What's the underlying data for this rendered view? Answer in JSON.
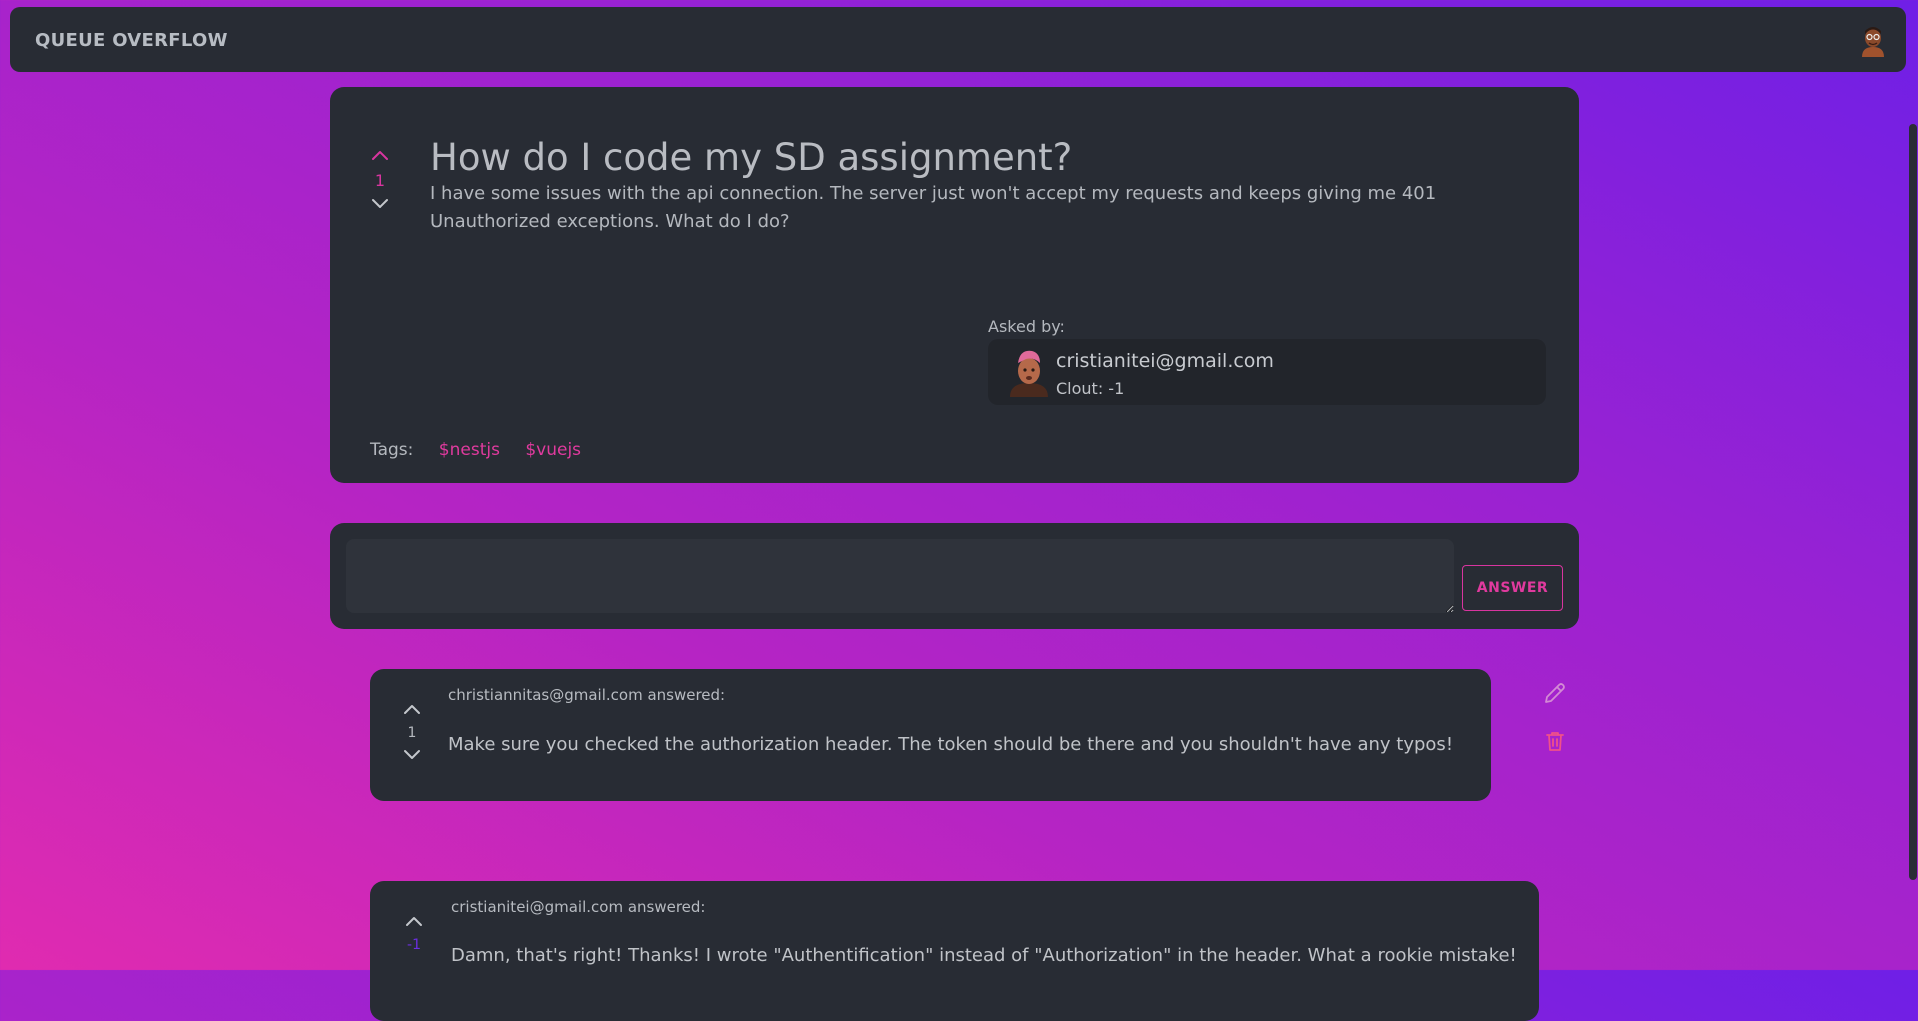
{
  "app": {
    "brand": "QUEUE OVERFLOW"
  },
  "question": {
    "title": "How do I code my SD assignment?",
    "body": "I have some issues with the api connection. The server just won't accept my requests and keeps giving me 401 Unauthorized exceptions. What do I do?",
    "votes": "1",
    "asked_by_label": "Asked by:",
    "author_email": "cristianitei@gmail.com",
    "author_clout": "Clout: -1",
    "tags_label": "Tags:",
    "tags": [
      "$nestjs",
      "$vuejs"
    ]
  },
  "answer_form": {
    "input_value": "",
    "submit_label": "ANSWER"
  },
  "answers": [
    {
      "author": "christiannitas@gmail.com answered:",
      "votes": "1",
      "text": "Make sure you checked the authorization header. The token should be there and you shouldn't have any typos!"
    },
    {
      "author": "cristianitei@gmail.com answered:",
      "votes": "-1",
      "text": "Damn, that's right! Thanks! I wrote \"Authentification\" instead of \"Authorization\" in the header. What a rookie mistake!"
    }
  ],
  "colors": {
    "accent": "#e03a9e",
    "card": "#282c34",
    "downvoted": "#6b2ee0"
  },
  "icons": {
    "upvote": "chevron-up-icon",
    "downvote": "chevron-down-icon",
    "edit": "pencil-icon",
    "delete": "trash-icon"
  }
}
